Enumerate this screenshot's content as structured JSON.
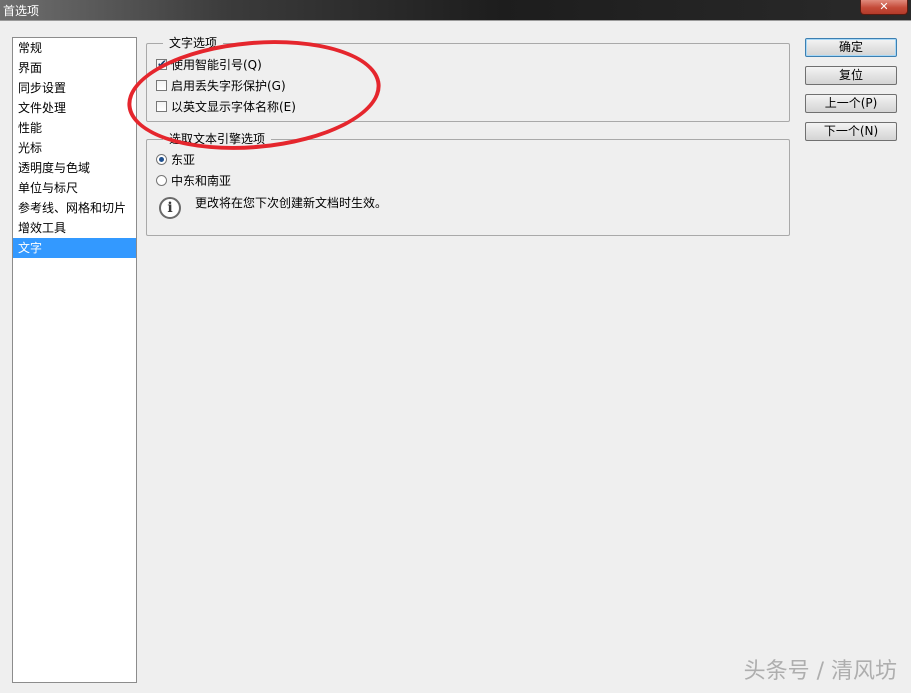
{
  "window": {
    "title": "首选项",
    "close_icon": "✕"
  },
  "sidebar": {
    "items": [
      {
        "label": "常规"
      },
      {
        "label": "界面"
      },
      {
        "label": "同步设置"
      },
      {
        "label": "文件处理"
      },
      {
        "label": "性能"
      },
      {
        "label": "光标"
      },
      {
        "label": "透明度与色域"
      },
      {
        "label": "单位与标尺"
      },
      {
        "label": "参考线、网格和切片"
      },
      {
        "label": "增效工具"
      },
      {
        "label": "文字",
        "selected": true
      }
    ]
  },
  "text_options": {
    "legend": "文字选项",
    "smart_quotes": {
      "label": "使用智能引号(Q)",
      "checked": true
    },
    "missing_glyph": {
      "label": "启用丢失字形保护(G)",
      "checked": false
    },
    "english_font_names": {
      "label": "以英文显示字体名称(E)",
      "checked": false
    }
  },
  "text_engine": {
    "legend": "选取文本引擎选项",
    "east_asia": {
      "label": "东亚",
      "selected": true
    },
    "middle_east": {
      "label": "中东和南亚",
      "selected": false
    },
    "info_text": "更改将在您下次创建新文档时生效。",
    "info_icon": "i"
  },
  "buttons": {
    "ok": "确定",
    "reset": "复位",
    "prev": "上一个(P)",
    "next": "下一个(N)"
  },
  "watermark": "头条号 / 清风坊"
}
